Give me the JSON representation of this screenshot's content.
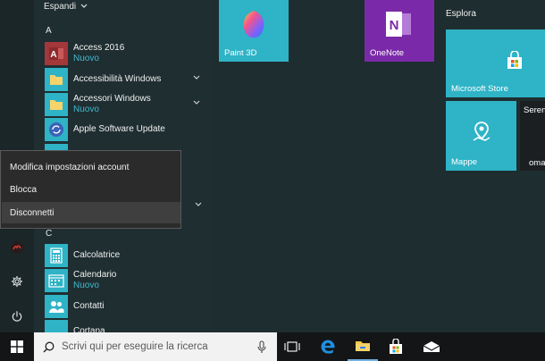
{
  "applist": {
    "expand_label": "Espandi",
    "letters": {
      "a": "A",
      "c": "C"
    },
    "items": [
      {
        "name": "Access 2016",
        "sub": "Nuovo"
      },
      {
        "name": "Accessibilità Windows",
        "sub": ""
      },
      {
        "name": "Accessori Windows",
        "sub": "Nuovo"
      },
      {
        "name": "Apple Software Update",
        "sub": ""
      },
      {
        "name": "Calcolatrice",
        "sub": ""
      },
      {
        "name": "Calendario",
        "sub": "Nuovo"
      },
      {
        "name": "Contatti",
        "sub": ""
      },
      {
        "name": "Cortana",
        "sub": ""
      }
    ]
  },
  "account_menu": {
    "items": [
      "Modifica impostazioni account",
      "Blocca",
      "Disconnetti"
    ]
  },
  "tiles": {
    "explore_group": "Esplora",
    "paint3d": "Paint 3D",
    "onenote": "OneNote",
    "store": "Microsoft Store",
    "maps": "Mappe",
    "partial_top": "Seren",
    "partial_bottom": "oma"
  },
  "taskbar": {
    "search_placeholder": "Scrivi qui per eseguire la ricerca"
  },
  "icons": {
    "start": "windows-logo-icon",
    "search": "search-icon",
    "mic": "microphone-icon",
    "taskview": "task-view-icon",
    "edge": "edge-icon",
    "explorer": "folder-icon",
    "store": "store-icon",
    "mail": "mail-icon",
    "settings": "gear-icon",
    "power": "power-icon"
  },
  "colors": {
    "accent_teal": "#2fb3c6",
    "onenote_purple": "#7a2aa8",
    "access_red": "#a4373a",
    "link_blue": "#3fbad0"
  }
}
